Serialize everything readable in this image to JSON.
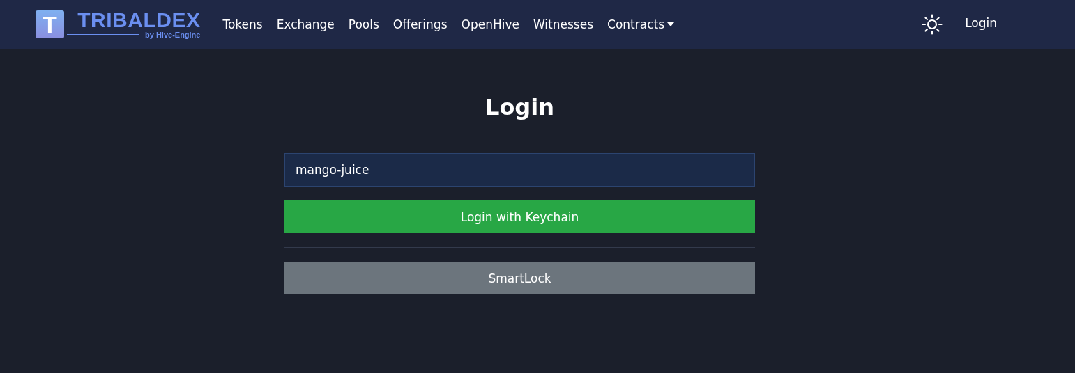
{
  "navbar": {
    "logo": {
      "letter": "T",
      "name": "TRIBALDEX",
      "tagline": "by Hive-Engine"
    },
    "links": [
      {
        "label": "Tokens",
        "kind": "link"
      },
      {
        "label": "Exchange",
        "kind": "link"
      },
      {
        "label": "Pools",
        "kind": "link"
      },
      {
        "label": "Offerings",
        "kind": "link"
      },
      {
        "label": "OpenHive",
        "kind": "link"
      },
      {
        "label": "Witnesses",
        "kind": "link"
      },
      {
        "label": "Contracts",
        "kind": "dropdown"
      }
    ],
    "login": "Login"
  },
  "login_form": {
    "title": "Login",
    "username": "mango-juice",
    "keychain_button": "Login with Keychain",
    "smartlock_button": "SmartLock"
  }
}
